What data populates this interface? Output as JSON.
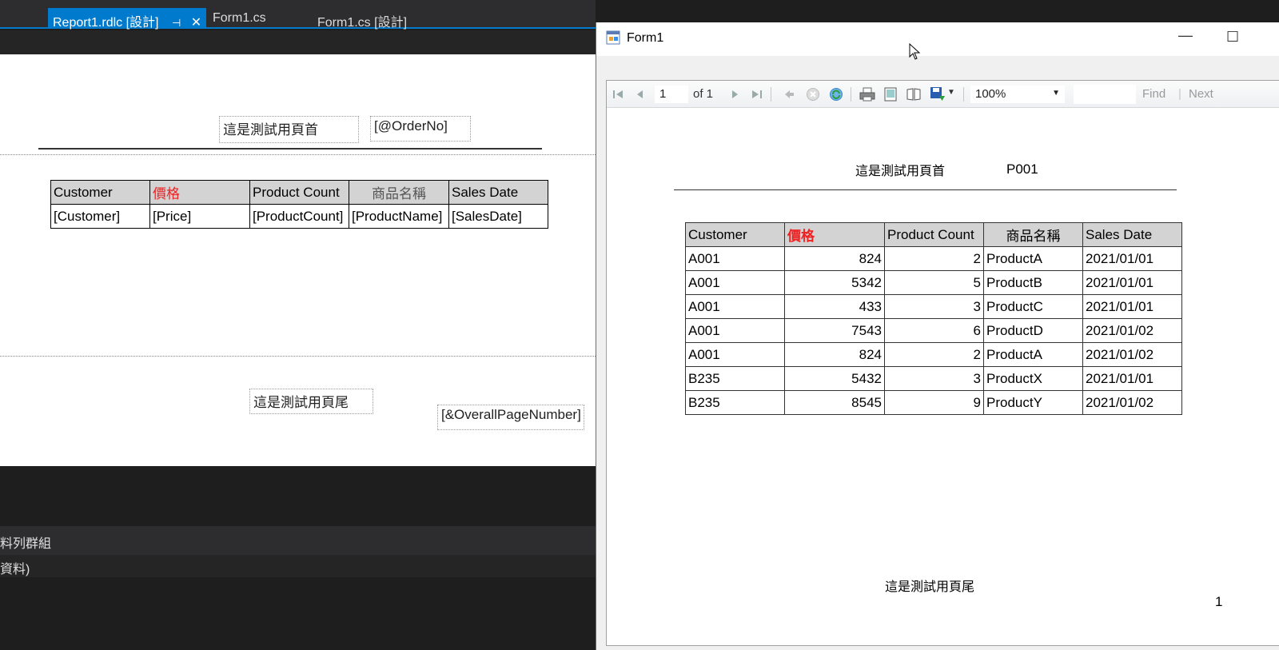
{
  "vs_tabs": [
    {
      "label": "Report1.rdlc [設計]",
      "pin": "⊣",
      "close": "✕"
    },
    {
      "label": "Form1.cs"
    },
    {
      "label": "Form1.cs [設計]"
    }
  ],
  "designer": {
    "page_header_text": "這是測試用頁首",
    "order_no_expr": "[@OrderNo]",
    "table_headers": [
      "Customer",
      "價格",
      "Product Count",
      "商品名稱",
      "Sales Date"
    ],
    "table_fields": [
      "[Customer]",
      "[Price]",
      "[ProductCount]",
      "[ProductName]",
      "[SalesDate]"
    ],
    "page_footer_text": "這是測試用頁尾",
    "page_number_expr": "[&OverallPageNumber]"
  },
  "bottom_panels": {
    "panel1_text": "料列群組",
    "panel2_text": "資料)"
  },
  "form": {
    "title": "Form1",
    "minimize": "—",
    "maximize": "☐",
    "toolbar": {
      "page_value": "1",
      "of_label": "of 1",
      "zoom": "100%",
      "find_label": "Find",
      "next_label": "Next",
      "separator": "|"
    },
    "report": {
      "header_text": "這是測試用頁首",
      "order_no": "P001",
      "table_headers": [
        "Customer",
        "價格",
        "Product Count",
        "商品名稱",
        "Sales Date"
      ],
      "rows": [
        [
          "A001",
          "824",
          "2",
          "ProductA",
          "2021/01/01"
        ],
        [
          "A001",
          "5342",
          "5",
          "ProductB",
          "2021/01/01"
        ],
        [
          "A001",
          "433",
          "3",
          "ProductC",
          "2021/01/01"
        ],
        [
          "A001",
          "7543",
          "6",
          "ProductD",
          "2021/01/02"
        ],
        [
          "A001",
          "824",
          "2",
          "ProductA",
          "2021/01/02"
        ],
        [
          "B235",
          "5432",
          "3",
          "ProductX",
          "2021/01/01"
        ],
        [
          "B235",
          "8545",
          "9",
          "ProductY",
          "2021/01/02"
        ]
      ],
      "footer_text": "這是測試用頁尾",
      "page_number": "1"
    }
  },
  "colors": {
    "accent": "#007acc",
    "red_header": "#ee2222"
  }
}
